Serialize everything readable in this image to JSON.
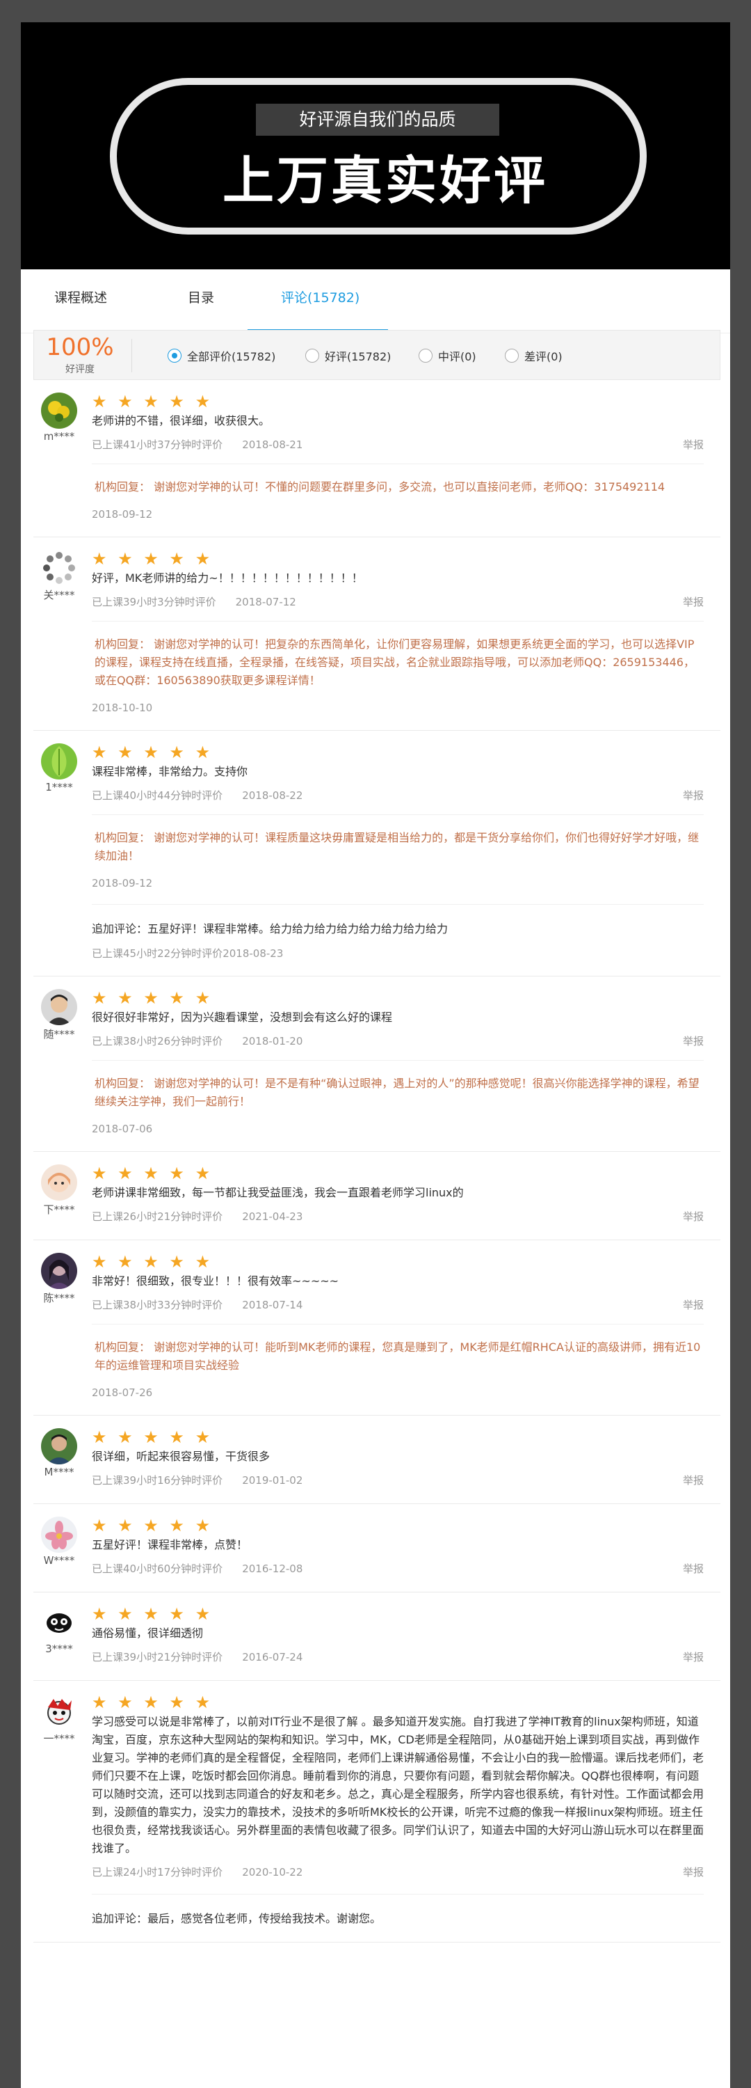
{
  "banner": {
    "subtitle": "好评源自我们的品质",
    "title": "上万真实好评"
  },
  "tabs": [
    {
      "label": "课程概述"
    },
    {
      "label": "目录"
    },
    {
      "label": "评论(15782)"
    }
  ],
  "rating": {
    "percent": "100%",
    "label": "好评度"
  },
  "filters": [
    {
      "label": "全部评价(15782)",
      "checked": true
    },
    {
      "label": "好评(15782)",
      "checked": false
    },
    {
      "label": "中评(0)",
      "checked": false
    },
    {
      "label": "差评(0)",
      "checked": false
    }
  ],
  "reviews": [
    {
      "user": "m****",
      "avatar": "yellow-flower",
      "stars": "★ ★ ★ ★ ★",
      "text": "老师讲的不错，很详细，收获很大。",
      "study": "已上课41小时37分钟时评价",
      "date": "2018-08-21",
      "report": "举报",
      "reply": "机构回复：  谢谢您对学神的认可！不懂的问题要在群里多问，多交流，也可以直接问老师，老师QQ：3175492114",
      "reply_date": "2018-09-12"
    },
    {
      "user": "关****",
      "avatar": "spinner",
      "stars": "★ ★ ★ ★ ★",
      "text": "好评，MK老师讲的给力~！！！！！！！！！！！！！",
      "study": "已上课39小时3分钟时评价",
      "date": "2018-07-12",
      "report": "举报",
      "reply": "机构回复：  谢谢您对学神的认可！把复杂的东西简单化，让你们更容易理解，如果想更系统更全面的学习，也可以选择VIP的课程，课程支持在线直播，全程录播，在线答疑，项目实战，名企就业跟踪指导哦，可以添加老师QQ：2659153446，或在QQ群：160563890获取更多课程详情！",
      "reply_date": "2018-10-10"
    },
    {
      "user": "1****",
      "avatar": "green-leaf",
      "stars": "★ ★ ★ ★ ★",
      "text": "课程非常棒，非常给力。支持你",
      "study": "已上课40小时44分钟时评价",
      "date": "2018-08-22",
      "report": "举报",
      "reply": "机构回复：  谢谢您对学神的认可！课程质量这块毋庸置疑是相当给力的，都是干货分享给你们，你们也得好好学才好哦，继续加油！",
      "reply_date": "2018-09-12",
      "append": "追加评论：五星好评！课程非常棒。给力给力给力给力给力给力给力给力",
      "append_meta": "已上课45小时22分钟时评价",
      "append_date": "2018-08-23"
    },
    {
      "user": "随****",
      "avatar": "man-photo",
      "stars": "★ ★ ★ ★ ★",
      "text": "很好很好非常好，因为兴趣看课堂，没想到会有这么好的课程",
      "study": "已上课38小时26分钟时评价",
      "date": "2018-01-20",
      "report": "举报",
      "reply": "机构回复：  谢谢您对学神的认可！是不是有种“确认过眼神，遇上对的人”的那种感觉呢！很高兴你能选择学神的课程，希望继续关注学神，我们一起前行！",
      "reply_date": "2018-07-06"
    },
    {
      "user": "下****",
      "avatar": "anime-girl",
      "stars": "★ ★ ★ ★ ★",
      "text": "老师讲课非常细致，每一节都让我受益匪浅，我会一直跟着老师学习linux的",
      "study": "已上课26小时21分钟时评价",
      "date": "2021-04-23",
      "report": "举报"
    },
    {
      "user": "陈****",
      "avatar": "dark-portrait",
      "stars": "★ ★ ★ ★ ★",
      "text": "非常好！很细致，很专业！！！很有效率~~~~~",
      "study": "已上课38小时33分钟时评价",
      "date": "2018-07-14",
      "report": "举报",
      "reply": "机构回复：  谢谢您对学神的认可！能听到MK老师的课程，您真是赚到了，MK老师是红帽RHCA认证的高级讲师，拥有近10年的运维管理和项目实战经验",
      "reply_date": "2018-07-26"
    },
    {
      "user": "M****",
      "avatar": "man-green",
      "stars": "★ ★ ★ ★ ★",
      "text": "很详细，听起来很容易懂，干货很多",
      "study": "已上课39小时16分钟时评价",
      "date": "2019-01-02",
      "report": "举报"
    },
    {
      "user": "W****",
      "avatar": "pink-flower",
      "stars": "★ ★ ★ ★ ★",
      "text": "五星好评！课程非常棒，点赞！",
      "study": "已上课40小时60分钟时评价",
      "date": "2016-12-08",
      "report": "举报"
    },
    {
      "user": "3****",
      "avatar": "cartoon-bw",
      "stars": "★ ★ ★ ★ ★",
      "text": "通俗易懂，很详细透彻",
      "study": "已上课39小时21分钟时评价",
      "date": "2016-07-24",
      "report": "举报"
    },
    {
      "user": "一****",
      "avatar": "cartoon-red",
      "stars": "★ ★ ★ ★ ★",
      "text": "学习感受可以说是非常棒了，以前对IT行业不是很了解 。最多知道开发实施。自打我进了学神IT教育的linux架构师班，知道淘宝，百度，京东这种大型网站的架构和知识。学习中，MK，CD老师是全程陪同，从0基础开始上课到项目实战，再到做作业复习。学神的老师们真的是全程督促，全程陪同，老师们上课讲解通俗易懂，不会让小白的我一脸懵逼。课后找老师们，老师们只要不在上课，吃饭时都会回你消息。睡前看到你的消息，只要你有问题，看到就会帮你解决。QQ群也很棒啊，有问题可以随时交流，还可以找到志同道合的好友和老乡。总之，真心是全程服务，所学内容也很系统，有针对性。工作面试都会用到，没颜值的靠实力，没实力的靠技术，没技术的多听听MK校长的公开课，听完不过瘾的像我一样报linux架构师班。班主任也很负责，经常找我谈话心。另外群里面的表情包收藏了很多。同学们认识了，知道去中国的大好河山游山玩水可以在群里面找谁了。",
      "study": "已上课24小时17分钟时评价",
      "date": "2020-10-22",
      "report": "举报",
      "append": "追加评论：最后，感觉各位老师，传授给我技术。谢谢您。"
    }
  ]
}
